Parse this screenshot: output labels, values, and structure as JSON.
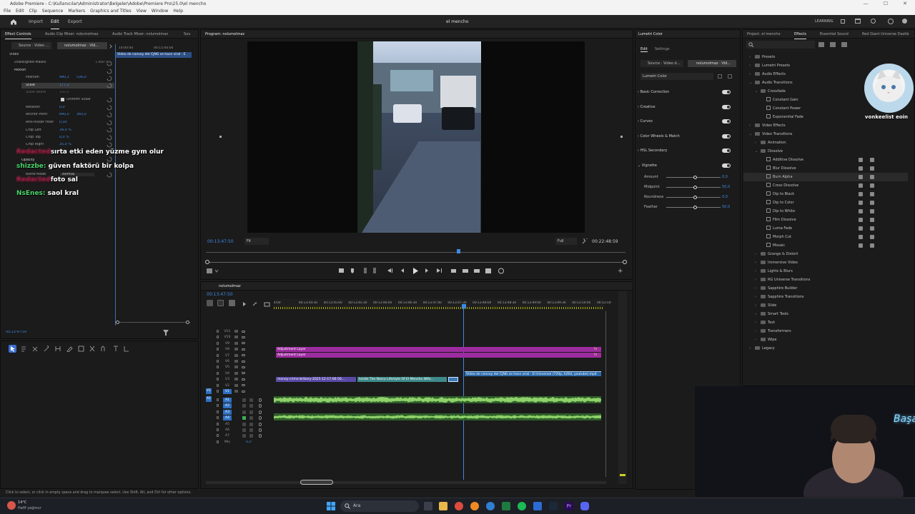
{
  "window": {
    "title": "Adobe Premiere - C:\\Kullanıcılar\\Administrator\\Belgeler\\Adobe\\Premiere Pro\\25.0\\el mencho",
    "min": "—",
    "max": "☐",
    "close": "✕"
  },
  "menu": [
    "File",
    "Edit",
    "Clip",
    "Sequence",
    "Markers",
    "Graphics and Titles",
    "View",
    "Window",
    "Help"
  ],
  "workspace": {
    "tabs": [
      "Import",
      "Edit",
      "Export"
    ],
    "active": "Edit",
    "project_name": "el mencho",
    "learning": "LEARNING"
  },
  "effect_controls": {
    "tabs": [
      "Effect Controls",
      "Audio Clip Mixer: nolumolmaz",
      "Audio Track Mixer: nolumolmaz",
      "Sou"
    ],
    "source": "Source · Video ...",
    "sequence": "nolumolmaz · Vid...",
    "section_video": "Video",
    "masks": "Unassigned Masks",
    "clear_all": "Clear all",
    "motion": "Motion",
    "props": [
      {
        "name": "Position",
        "value": "990,3",
        "value2": "536,0"
      },
      {
        "name": "Scale",
        "value": "177,2",
        "value2": ""
      },
      {
        "name": "Scale Width",
        "value": "100,0",
        "value2": ""
      },
      {
        "name": "Uniform Scale",
        "value": "",
        "value2": ""
      },
      {
        "name": "Rotation",
        "value": "0,0",
        "value2": ""
      },
      {
        "name": "Anchor Point",
        "value": "640,0",
        "value2": "360,0"
      },
      {
        "name": "Anti-flicker Filter",
        "value": "0,00",
        "value2": ""
      },
      {
        "name": "Crop Left",
        "value": "34,0 %",
        "value2": ""
      },
      {
        "name": "Crop Top",
        "value": "0,0 %",
        "value2": ""
      },
      {
        "name": "Crop Right",
        "value": "35,0 %",
        "value2": ""
      }
    ],
    "opacity": "Opacity",
    "blend_mode": "Blend Mode",
    "blend_value": "Normal",
    "ruler_a": "14:00:00",
    "ruler_b": "00:15:00:00",
    "clip_label": "Video de convoy del CJNG se hace viral · E",
    "timecode": "00:13:47:50"
  },
  "chat": [
    {
      "user": "Redacted",
      "text": "sırta etki eden yüzme gym olur",
      "color": "#d4285a"
    },
    {
      "user": "shizzbe:",
      "text": "güven faktörü bir kolpa",
      "color": "#49d36a"
    },
    {
      "user": "Redacted",
      "text": "foto sal",
      "color": "#d4285a"
    },
    {
      "user": "NsEnes:",
      "text": "saol kral",
      "color": "#49d36a"
    }
  ],
  "program": {
    "tab": "Program: nolumolmaz",
    "timecode": "00:13:47:50",
    "fit": "Fit",
    "quality": "Full",
    "duration": "00:22:48:59"
  },
  "timeline": {
    "tab": "nolumolmaz",
    "timecode": "00:13:47:50",
    "ruler": [
      "4:00",
      "00:13:44:30",
      "00:13:45:00",
      "00:13:45:30",
      "00:13:46:00",
      "00:13:46:30",
      "00:13:47:00",
      "00:13:47:30",
      "00:13:48:00",
      "00:13:48:30",
      "00:13:49:00",
      "00:13:49:30",
      "00:13:50:00",
      "00:13:50:"
    ],
    "video_tracks": [
      "V11",
      "V10",
      "V9",
      "V8",
      "V7",
      "V6",
      "V5",
      "V4",
      "V3",
      "V2",
      "V1"
    ],
    "audio_tracks": [
      "A1",
      "A2",
      "A3",
      "A4",
      "A5",
      "A6",
      "A7",
      "Mix"
    ],
    "mix_value": "0,0",
    "clips": {
      "adj1": "Adjustment Layer",
      "adj2": "Adjustment Layer",
      "v3_a": "money-crime-bribery-2025-12-17-06-56...",
      "v3_b": "Inside The Narco Lifestyle Of El Mencho Wife...",
      "v4": "Video de convoy del CJNG se hace viral · El Universal (720p, h264, youtube).mp4",
      "fx": "fx"
    }
  },
  "lumetri": {
    "tab": "Lumetri Color",
    "subtabs": [
      "Edit",
      "Settings"
    ],
    "source": "Source · Video d...",
    "sequence": "nolumolmaz · Vid...",
    "effect": "Lumetri Color",
    "sections": [
      "Basic Correction",
      "Creative",
      "Curves",
      "Color Wheels & Match",
      "HSL Secondary",
      "Vignette"
    ],
    "vignette": [
      {
        "name": "Amount",
        "value": "0,0"
      },
      {
        "name": "Midpoint",
        "value": "50,0"
      },
      {
        "name": "Roundness",
        "value": "0,0"
      },
      {
        "name": "Feather",
        "value": "50,0"
      }
    ]
  },
  "effects_panel": {
    "tabs": [
      "Project: el mencho",
      "Effects",
      "Essential Sound",
      "Red Giant Universe Dashb"
    ],
    "active": "Effects",
    "items": [
      {
        "label": "Presets",
        "level": 0,
        "kind": "folder",
        "open": false
      },
      {
        "label": "Lumetri Presets",
        "level": 0,
        "kind": "folder",
        "open": false
      },
      {
        "label": "Audio Effects",
        "level": 0,
        "kind": "folder",
        "open": false
      },
      {
        "label": "Audio Transitions",
        "level": 0,
        "kind": "folder",
        "open": true
      },
      {
        "label": "Crossfade",
        "level": 1,
        "kind": "folder",
        "open": true
      },
      {
        "label": "Constant Gain",
        "level": 2,
        "kind": "fx",
        "open": false
      },
      {
        "label": "Constant Power",
        "level": 2,
        "kind": "fx",
        "open": false
      },
      {
        "label": "Exponential Fade",
        "level": 2,
        "kind": "fx",
        "open": false
      },
      {
        "label": "Video Effects",
        "level": 0,
        "kind": "folder",
        "open": false
      },
      {
        "label": "Video Transitions",
        "level": 0,
        "kind": "folder",
        "open": true
      },
      {
        "label": "Animation",
        "level": 1,
        "kind": "folder",
        "open": false
      },
      {
        "label": "Dissolve",
        "level": 1,
        "kind": "folder",
        "open": true
      },
      {
        "label": "Additive Dissolve",
        "level": 2,
        "kind": "fx",
        "open": false
      },
      {
        "label": "Blur Dissolve",
        "level": 2,
        "kind": "fx",
        "open": false
      },
      {
        "label": "Burn Alpha",
        "level": 2,
        "kind": "fx",
        "open": false
      },
      {
        "label": "Cross Dissolve",
        "level": 2,
        "kind": "fx",
        "open": false
      },
      {
        "label": "Dip to Black",
        "level": 2,
        "kind": "fx",
        "open": false
      },
      {
        "label": "Dip to Color",
        "level": 2,
        "kind": "fx",
        "open": false
      },
      {
        "label": "Dip to White",
        "level": 2,
        "kind": "fx",
        "open": false
      },
      {
        "label": "Film Dissolve",
        "level": 2,
        "kind": "fx",
        "open": false
      },
      {
        "label": "Luma Fade",
        "level": 2,
        "kind": "fx",
        "open": false
      },
      {
        "label": "Morph Cut",
        "level": 2,
        "kind": "fx",
        "open": false
      },
      {
        "label": "Mosaic",
        "level": 2,
        "kind": "fx",
        "open": false
      },
      {
        "label": "Grange & Distort",
        "level": 1,
        "kind": "folder",
        "open": false
      },
      {
        "label": "Immersive Video",
        "level": 1,
        "kind": "folder",
        "open": false
      },
      {
        "label": "Lights & Blurs",
        "level": 1,
        "kind": "folder",
        "open": false
      },
      {
        "label": "RG Universe Transitions",
        "level": 1,
        "kind": "folder",
        "open": false
      },
      {
        "label": "Sapphire Builder",
        "level": 1,
        "kind": "folder",
        "open": false
      },
      {
        "label": "Sapphire Transitions",
        "level": 1,
        "kind": "folder",
        "open": false
      },
      {
        "label": "Slide",
        "level": 1,
        "kind": "folder",
        "open": false
      },
      {
        "label": "Smart Tools",
        "level": 1,
        "kind": "folder",
        "open": false
      },
      {
        "label": "Text",
        "level": 1,
        "kind": "folder",
        "open": false
      },
      {
        "label": "Transformers",
        "level": 1,
        "kind": "folder",
        "open": false
      },
      {
        "label": "Wipe",
        "level": 1,
        "kind": "folder",
        "open": false
      },
      {
        "label": "Legacy",
        "level": 0,
        "kind": "folder",
        "open": false
      }
    ]
  },
  "overlay": {
    "cat_caption": "vonkeelist eoin",
    "neon": "Başa"
  },
  "status": "Click to select, or click in empty space and drag to marquee select. Use Shift, Alt, and Ctrl for other options.",
  "taskbar": {
    "weather_temp": "14°C",
    "weather_text": "Hafif yağmur",
    "search": "Ara"
  }
}
